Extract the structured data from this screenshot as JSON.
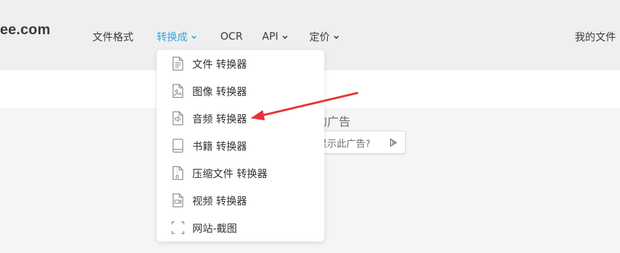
{
  "brand": {
    "logo_text": "ee.com"
  },
  "nav": {
    "items": [
      {
        "label": "文件格式",
        "active": false,
        "has_dropdown": false
      },
      {
        "label": "转换成",
        "active": true,
        "has_dropdown": true
      },
      {
        "label": "OCR",
        "active": false,
        "has_dropdown": false
      },
      {
        "label": "API",
        "active": false,
        "has_dropdown": true
      },
      {
        "label": "定价",
        "active": false,
        "has_dropdown": true
      }
    ],
    "my_files": "我的文件"
  },
  "dropdown": {
    "items": [
      {
        "label": "文件 转换器",
        "icon": "document-icon"
      },
      {
        "label": "图像 转换器",
        "icon": "image-file-icon"
      },
      {
        "label": "音频 转换器",
        "icon": "audio-file-icon"
      },
      {
        "label": "书籍 转换器",
        "icon": "book-icon"
      },
      {
        "label": "压缩文件 转换器",
        "icon": "archive-file-icon"
      },
      {
        "label": "视频 转换器",
        "icon": "video-file-icon"
      },
      {
        "label": "网站-截图",
        "icon": "screenshot-icon"
      }
    ]
  },
  "ad": {
    "title": "的广告",
    "button_label": "显示此广告?"
  },
  "colors": {
    "accent": "#2ea7e0",
    "annotation_arrow": "#e8333a",
    "icon_gray": "#8a8f96"
  }
}
